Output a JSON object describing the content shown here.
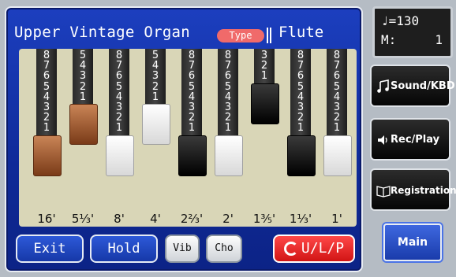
{
  "title": "Upper Vintage Organ",
  "type_badge": "Type",
  "type_value": "Flute",
  "tempo": {
    "note_symbol": "♩",
    "value": "=130",
    "measure_label": "M:",
    "measure_value": "1"
  },
  "drawbars": [
    {
      "footage": "16'",
      "numbers": [
        "8",
        "7",
        "6",
        "5",
        "4",
        "3",
        "2",
        "1"
      ],
      "color": "brown",
      "level": 8
    },
    {
      "footage": "5⅓'",
      "numbers": [
        "5",
        "4",
        "3",
        "2",
        "1"
      ],
      "color": "brown",
      "level": 5
    },
    {
      "footage": "8'",
      "numbers": [
        "8",
        "7",
        "6",
        "5",
        "4",
        "3",
        "2",
        "1"
      ],
      "color": "white",
      "level": 8
    },
    {
      "footage": "4'",
      "numbers": [
        "5",
        "4",
        "3",
        "2",
        "1"
      ],
      "color": "white",
      "level": 5
    },
    {
      "footage": "2⅔'",
      "numbers": [
        "8",
        "7",
        "6",
        "5",
        "4",
        "3",
        "2",
        "1"
      ],
      "color": "black",
      "level": 8
    },
    {
      "footage": "2'",
      "numbers": [
        "8",
        "7",
        "6",
        "5",
        "4",
        "3",
        "2",
        "1"
      ],
      "color": "white",
      "level": 8
    },
    {
      "footage": "1⅗'",
      "numbers": [
        "3",
        "2",
        "1"
      ],
      "color": "black",
      "level": 3
    },
    {
      "footage": "1⅓'",
      "numbers": [
        "8",
        "7",
        "6",
        "5",
        "4",
        "3",
        "2",
        "1"
      ],
      "color": "black",
      "level": 8
    },
    {
      "footage": "1'",
      "numbers": [
        "8",
        "7",
        "6",
        "5",
        "4",
        "3",
        "2",
        "1"
      ],
      "color": "white",
      "level": 8
    }
  ],
  "buttons": {
    "exit": "Exit",
    "hold": "Hold",
    "vib": "Vib",
    "cho": "Cho",
    "ulp": "U/L/P"
  },
  "side": {
    "sound": "Sound/KBD",
    "rec": "Rec/Play",
    "registration": "Registration",
    "main": "Main"
  },
  "colors": {
    "panel_blue": "#1c3fbf",
    "drawbar_bg": "#d9d6b7",
    "accent_red": "#f06a6a"
  }
}
